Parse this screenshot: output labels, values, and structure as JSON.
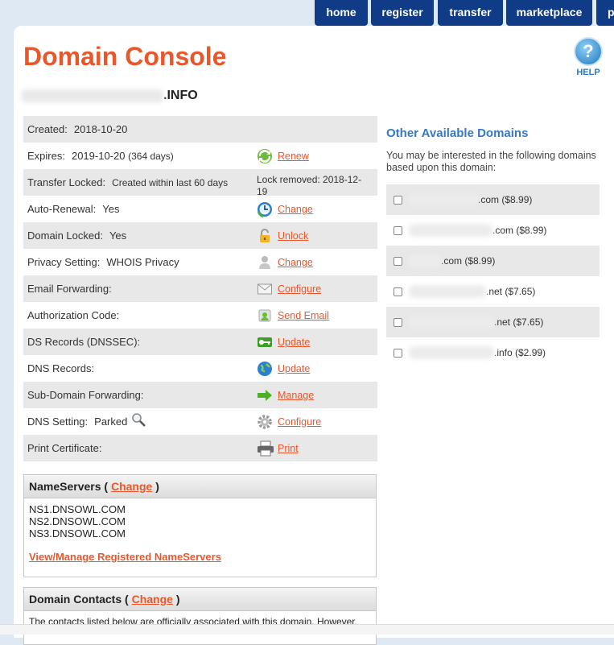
{
  "nav": {
    "tabs": [
      "home",
      "register",
      "transfer",
      "marketplace",
      "p"
    ]
  },
  "page": {
    "title": "Domain Console",
    "help_label": "HELP",
    "help_glyph": "?"
  },
  "domain": {
    "name_suffix": ".INFO"
  },
  "details": {
    "created_label": "Created:",
    "created_value": "2018-10-20",
    "expires_label": "Expires:",
    "expires_value": "2019-10-20",
    "expires_days": "(364 days)",
    "expires_action": "Renew",
    "transfer_label": "Transfer Locked:",
    "transfer_value": "Created within last 60 days",
    "transfer_note": "Lock removed: 2018-12-19",
    "autorenew_label": "Auto-Renewal:",
    "autorenew_value": "Yes",
    "autorenew_action": "Change",
    "domainlock_label": "Domain Locked:",
    "domainlock_value": "Yes",
    "domainlock_action": "Unlock",
    "privacy_label": "Privacy Setting:",
    "privacy_value": "WHOIS Privacy",
    "privacy_action": "Change",
    "email_label": "Email Forwarding:",
    "email_action": "Configure",
    "auth_label": "Authorization Code:",
    "auth_action": "Send Email",
    "ds_label": "DS Records (DNSSEC):",
    "ds_action": "Update",
    "dns_label": "DNS Records:",
    "dns_action": "Update",
    "subdomain_label": "Sub-Domain Forwarding:",
    "subdomain_action": "Manage",
    "dnssetting_label": "DNS Setting:",
    "dnssetting_value": "Parked",
    "dnssetting_action": "Configure",
    "print_label": "Print Certificate:",
    "print_action": "Print"
  },
  "nameservers": {
    "heading": "NameServers",
    "open_paren": "(",
    "close_paren": ")",
    "change_label": "Change",
    "list": [
      "NS1.DNSOWL.COM",
      "NS2.DNSOWL.COM",
      "NS3.DNSOWL.COM"
    ],
    "manage_link": "View/Manage Registered NameServers"
  },
  "contacts": {
    "heading": "Domain Contacts",
    "open_paren": "(",
    "close_paren": ")",
    "change_label": "Change",
    "text": "The contacts listed below are officially associated with this domain. However,"
  },
  "side": {
    "title": "Other Available Domains",
    "intro": "You may be interested in the following domains based upon this domain:",
    "options": [
      ".com ($8.99)",
      ".com ($8.99)",
      ".com ($8.99)",
      ".net ($7.65)",
      ".net ($7.65)",
      ".info ($2.99)"
    ]
  },
  "colors": {
    "accent": "#e8582d",
    "nav_bg": "#0f3b87",
    "link_blue": "#3579c2"
  }
}
